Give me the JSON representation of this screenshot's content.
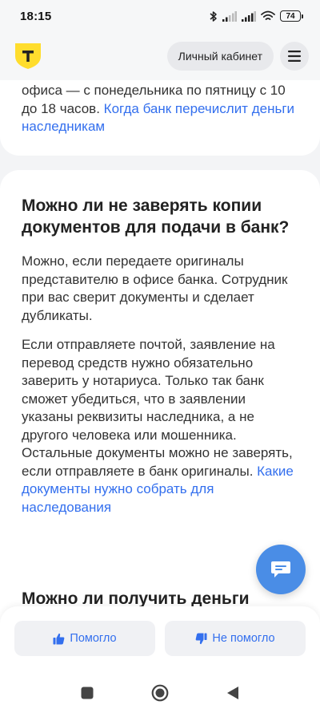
{
  "status": {
    "time": "18:15",
    "battery": "74"
  },
  "header": {
    "logo_letter": "Т",
    "cabinet_label": "Личный кабинет"
  },
  "card1": {
    "text_start": "офиса — с понедельника по пятницу с 10 до 18 часов. ",
    "link": "Когда банк перечислит деньги наследникам"
  },
  "card2": {
    "title": "Можно ли не заверять копии документов для подачи в банк?",
    "para1": "Можно, если передаете оригиналы представителю в офисе банка. Сотрудник при вас сверит документы и сделает дубликаты.",
    "para2_text": "Если отправляете почтой, заявление на перевод средств нужно обязательно заверить у нотариуса. Только так банк сможет убедиться, что в заявлении указаны реквизиты наследника, а не другого человека или мошенника. Остальные документы можно не заверять, если отправляете в банк оригиналы. ",
    "para2_link": "Какие документы нужно собрать для наследования"
  },
  "card3": {
    "title": "Можно ли получить деньги"
  },
  "feedback": {
    "helped": "Помогло",
    "not_helped": "Не помогло"
  },
  "colors": {
    "brand_yellow": "#ffdd2d",
    "link_blue": "#336fee",
    "fab_blue": "#4a8de6"
  }
}
